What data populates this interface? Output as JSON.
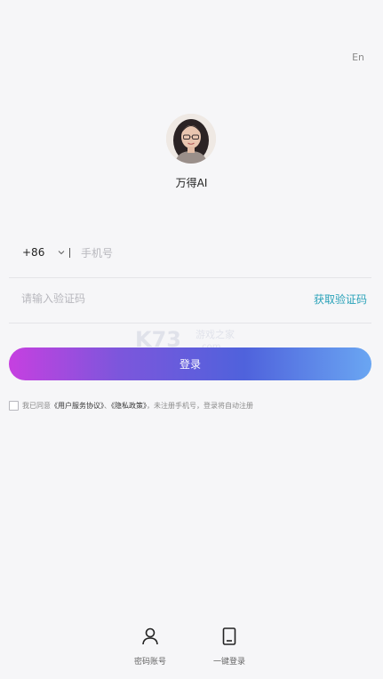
{
  "header": {
    "lang_switch": "En"
  },
  "app": {
    "name": "万得AI"
  },
  "phone": {
    "country_code": "+86",
    "placeholder": "手机号",
    "value": ""
  },
  "code": {
    "placeholder": "请输入验证码",
    "value": "",
    "get_code_label": "获取验证码"
  },
  "login": {
    "label": "登录",
    "gradient_start": "#c640e0",
    "gradient_end": "#6aa6f2"
  },
  "agreement": {
    "checked": false,
    "prefix": "我已同意",
    "user_agreement": "《用户服务协议》",
    "separator": "、",
    "privacy_policy": "《隐私政策》",
    "suffix": "，未注册手机号，登录将自动注册"
  },
  "bottom_options": {
    "password_login": {
      "label": "密码账号",
      "icon": "person-icon"
    },
    "one_click_login": {
      "label": "一键登录",
      "icon": "phone-icon"
    }
  },
  "colors": {
    "link_accent": "#2aa2b9",
    "background": "#f6f6f8"
  }
}
